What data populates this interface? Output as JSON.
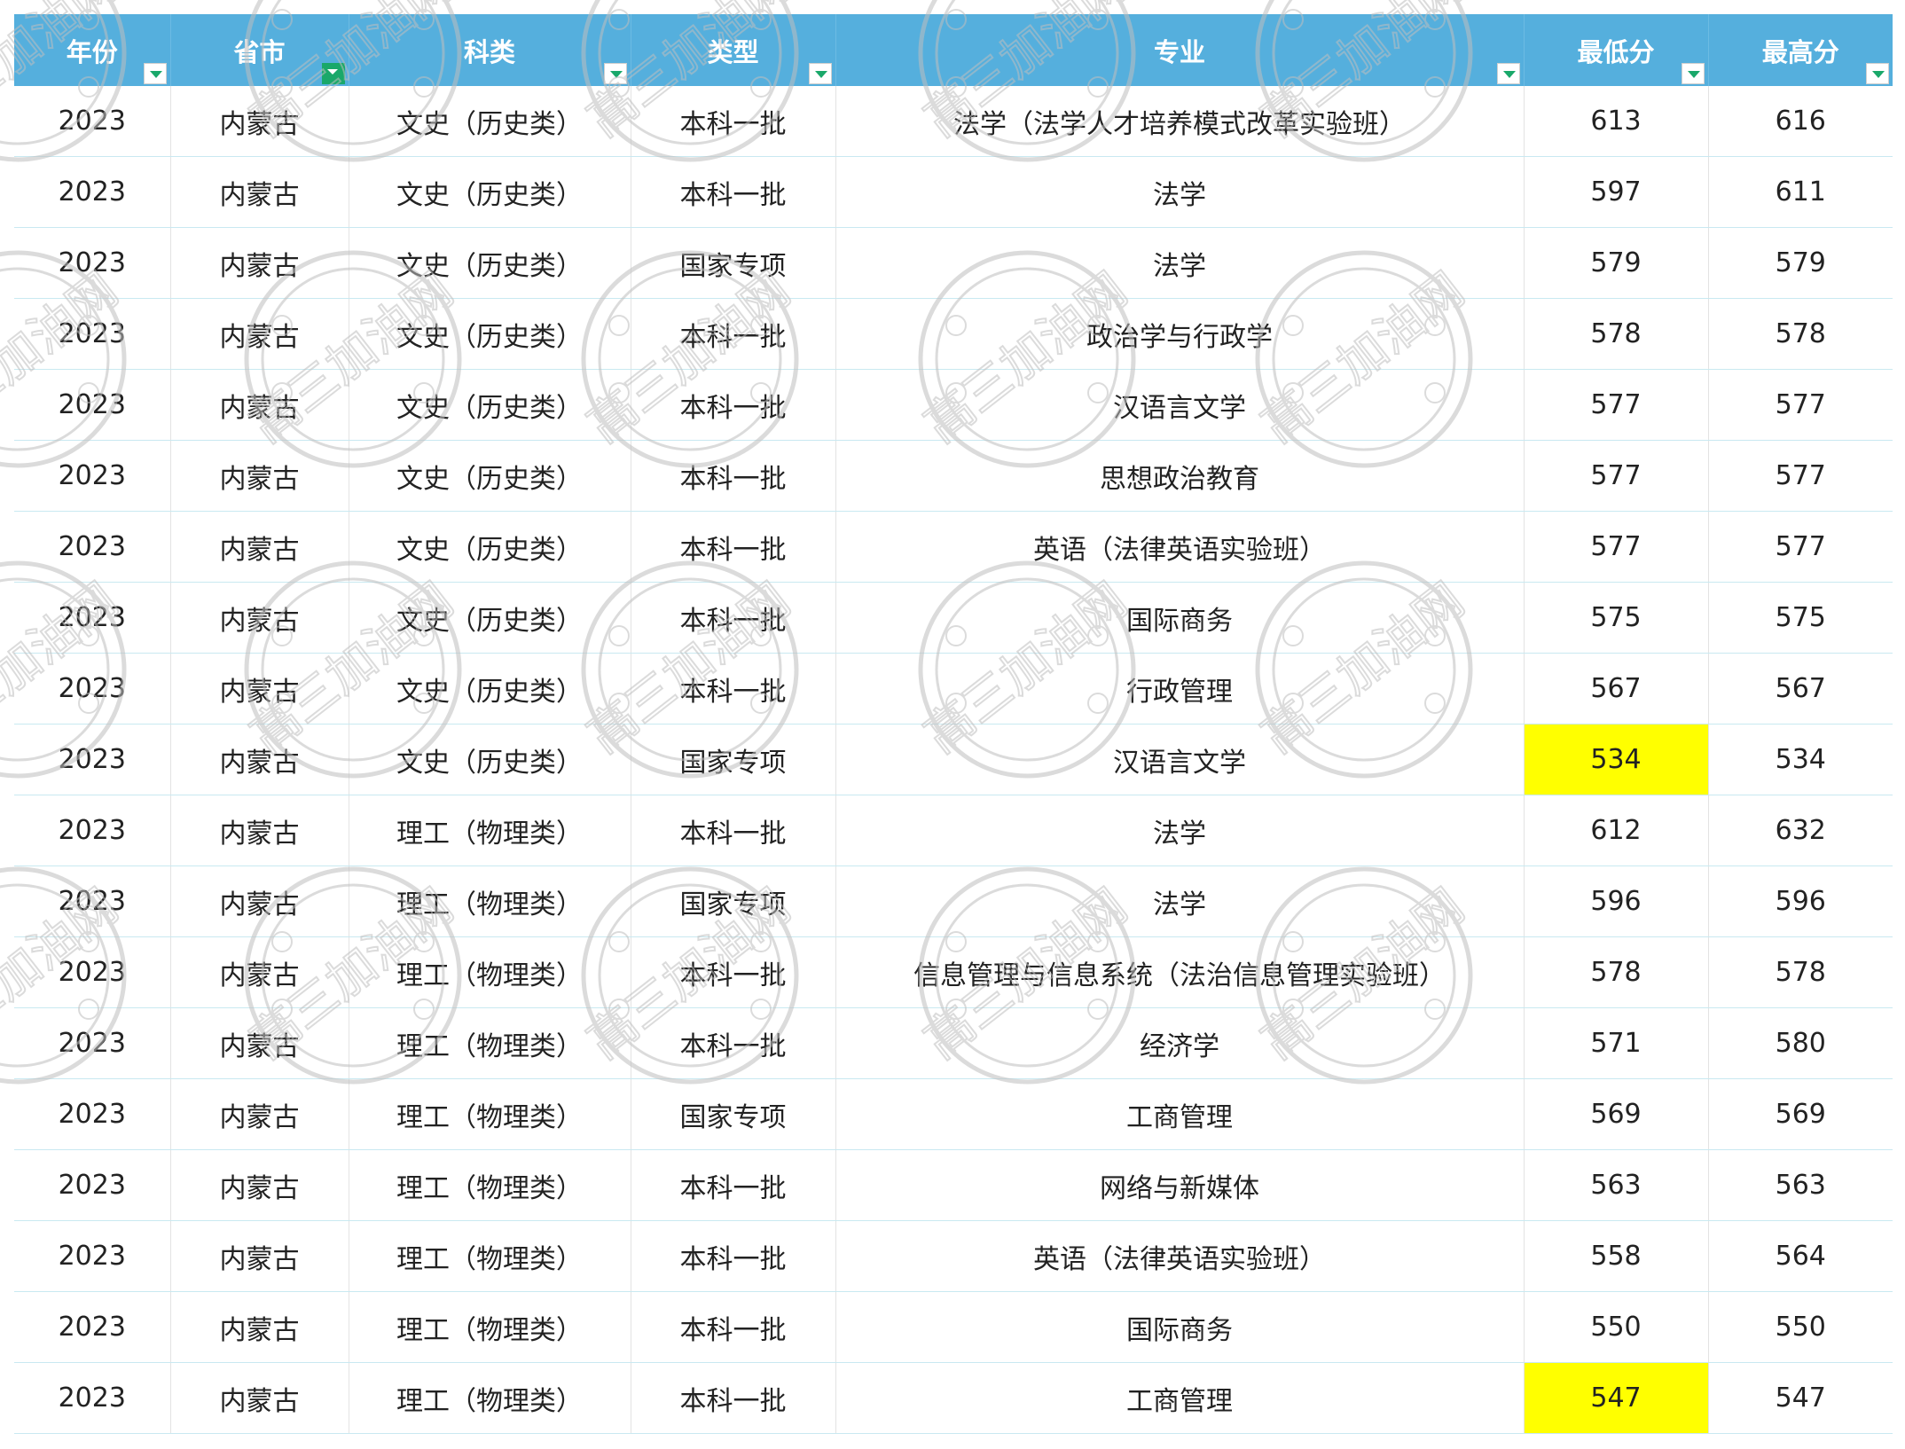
{
  "table": {
    "headers": [
      "年份",
      "省市",
      "科类",
      "类型",
      "专业",
      "最低分",
      "最高分"
    ],
    "filter_icons": [
      "filter-dropdown-icon",
      "filter-active-icon",
      "filter-dropdown-icon",
      "filter-dropdown-icon",
      "filter-dropdown-icon",
      "filter-dropdown-icon",
      "filter-dropdown-icon"
    ],
    "header_color": "#55afdd",
    "highlight_color": "#ffff00",
    "rows": [
      {
        "year": "2023",
        "province": "内蒙古",
        "category": "文史（历史类）",
        "type": "本科一批",
        "major": "法学（法学人才培养模式改革实验班）",
        "min": "613",
        "max": "616",
        "min_highlight": false
      },
      {
        "year": "2023",
        "province": "内蒙古",
        "category": "文史（历史类）",
        "type": "本科一批",
        "major": "法学",
        "min": "597",
        "max": "611",
        "min_highlight": false
      },
      {
        "year": "2023",
        "province": "内蒙古",
        "category": "文史（历史类）",
        "type": "国家专项",
        "major": "法学",
        "min": "579",
        "max": "579",
        "min_highlight": false
      },
      {
        "year": "2023",
        "province": "内蒙古",
        "category": "文史（历史类）",
        "type": "本科一批",
        "major": "政治学与行政学",
        "min": "578",
        "max": "578",
        "min_highlight": false
      },
      {
        "year": "2023",
        "province": "内蒙古",
        "category": "文史（历史类）",
        "type": "本科一批",
        "major": "汉语言文学",
        "min": "577",
        "max": "577",
        "min_highlight": false
      },
      {
        "year": "2023",
        "province": "内蒙古",
        "category": "文史（历史类）",
        "type": "本科一批",
        "major": "思想政治教育",
        "min": "577",
        "max": "577",
        "min_highlight": false
      },
      {
        "year": "2023",
        "province": "内蒙古",
        "category": "文史（历史类）",
        "type": "本科一批",
        "major": "英语（法律英语实验班）",
        "min": "577",
        "max": "577",
        "min_highlight": false
      },
      {
        "year": "2023",
        "province": "内蒙古",
        "category": "文史（历史类）",
        "type": "本科一批",
        "major": "国际商务",
        "min": "575",
        "max": "575",
        "min_highlight": false
      },
      {
        "year": "2023",
        "province": "内蒙古",
        "category": "文史（历史类）",
        "type": "本科一批",
        "major": "行政管理",
        "min": "567",
        "max": "567",
        "min_highlight": false
      },
      {
        "year": "2023",
        "province": "内蒙古",
        "category": "文史（历史类）",
        "type": "国家专项",
        "major": "汉语言文学",
        "min": "534",
        "max": "534",
        "min_highlight": true
      },
      {
        "year": "2023",
        "province": "内蒙古",
        "category": "理工（物理类）",
        "type": "本科一批",
        "major": "法学",
        "min": "612",
        "max": "632",
        "min_highlight": false
      },
      {
        "year": "2023",
        "province": "内蒙古",
        "category": "理工（物理类）",
        "type": "国家专项",
        "major": "法学",
        "min": "596",
        "max": "596",
        "min_highlight": false
      },
      {
        "year": "2023",
        "province": "内蒙古",
        "category": "理工（物理类）",
        "type": "本科一批",
        "major": "信息管理与信息系统（法治信息管理实验班）",
        "min": "578",
        "max": "578",
        "min_highlight": false
      },
      {
        "year": "2023",
        "province": "内蒙古",
        "category": "理工（物理类）",
        "type": "本科一批",
        "major": "经济学",
        "min": "571",
        "max": "580",
        "min_highlight": false
      },
      {
        "year": "2023",
        "province": "内蒙古",
        "category": "理工（物理类）",
        "type": "国家专项",
        "major": "工商管理",
        "min": "569",
        "max": "569",
        "min_highlight": false
      },
      {
        "year": "2023",
        "province": "内蒙古",
        "category": "理工（物理类）",
        "type": "本科一批",
        "major": "网络与新媒体",
        "min": "563",
        "max": "563",
        "min_highlight": false
      },
      {
        "year": "2023",
        "province": "内蒙古",
        "category": "理工（物理类）",
        "type": "本科一批",
        "major": "英语（法律英语实验班）",
        "min": "558",
        "max": "564",
        "min_highlight": false
      },
      {
        "year": "2023",
        "province": "内蒙古",
        "category": "理工（物理类）",
        "type": "本科一批",
        "major": "国际商务",
        "min": "550",
        "max": "550",
        "min_highlight": false
      },
      {
        "year": "2023",
        "province": "内蒙古",
        "category": "理工（物理类）",
        "type": "本科一批",
        "major": "工商管理",
        "min": "547",
        "max": "547",
        "min_highlight": true
      }
    ]
  },
  "watermark": {
    "text": "高三加油网",
    "color": "#bfbfbf"
  }
}
